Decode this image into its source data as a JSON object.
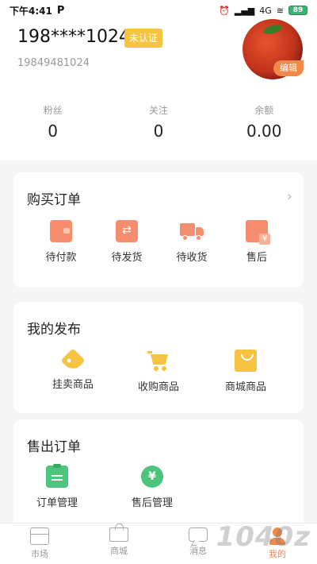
{
  "status_bar": {
    "time": "下午4:41",
    "app_icon": "P",
    "network": "4G",
    "battery": "89"
  },
  "profile": {
    "masked_phone": "198****1024",
    "verify_badge": "未认证",
    "phone": "19849481024",
    "avatar_icon": "tomato-avatar",
    "edit_label": "编辑"
  },
  "stats": [
    {
      "label": "粉丝",
      "value": "0"
    },
    {
      "label": "关注",
      "value": "0"
    },
    {
      "label": "余额",
      "value": "0.00"
    }
  ],
  "purchase_orders": {
    "title": "购买订单",
    "items": [
      {
        "label": "待付款",
        "icon": "wallet-icon"
      },
      {
        "label": "待发货",
        "icon": "shipping-card-icon"
      },
      {
        "label": "待收货",
        "icon": "truck-icon"
      },
      {
        "label": "售后",
        "icon": "after-sale-icon"
      }
    ]
  },
  "my_posts": {
    "title": "我的发布",
    "items": [
      {
        "label": "挂卖商品",
        "icon": "price-tag-icon"
      },
      {
        "label": "收购商品",
        "icon": "cart-icon"
      },
      {
        "label": "商城商品",
        "icon": "shopping-bag-icon"
      }
    ]
  },
  "sales_orders": {
    "title": "售出订单",
    "items": [
      {
        "label": "订单管理",
        "icon": "clipboard-icon"
      },
      {
        "label": "售后管理",
        "icon": "yen-coin-icon"
      }
    ]
  },
  "tabbar": [
    {
      "label": "市场",
      "icon": "store-icon",
      "active": false
    },
    {
      "label": "商城",
      "icon": "shopping-bag-icon",
      "active": false
    },
    {
      "label": "消息",
      "icon": "message-icon",
      "active": false
    },
    {
      "label": "我的",
      "icon": "profile-icon",
      "active": true
    }
  ],
  "watermark": "1040z",
  "colors": {
    "accent": "#f08a4b",
    "badge": "#f6c343",
    "order_icon": "#f58d6e",
    "green": "#4cc47c"
  }
}
